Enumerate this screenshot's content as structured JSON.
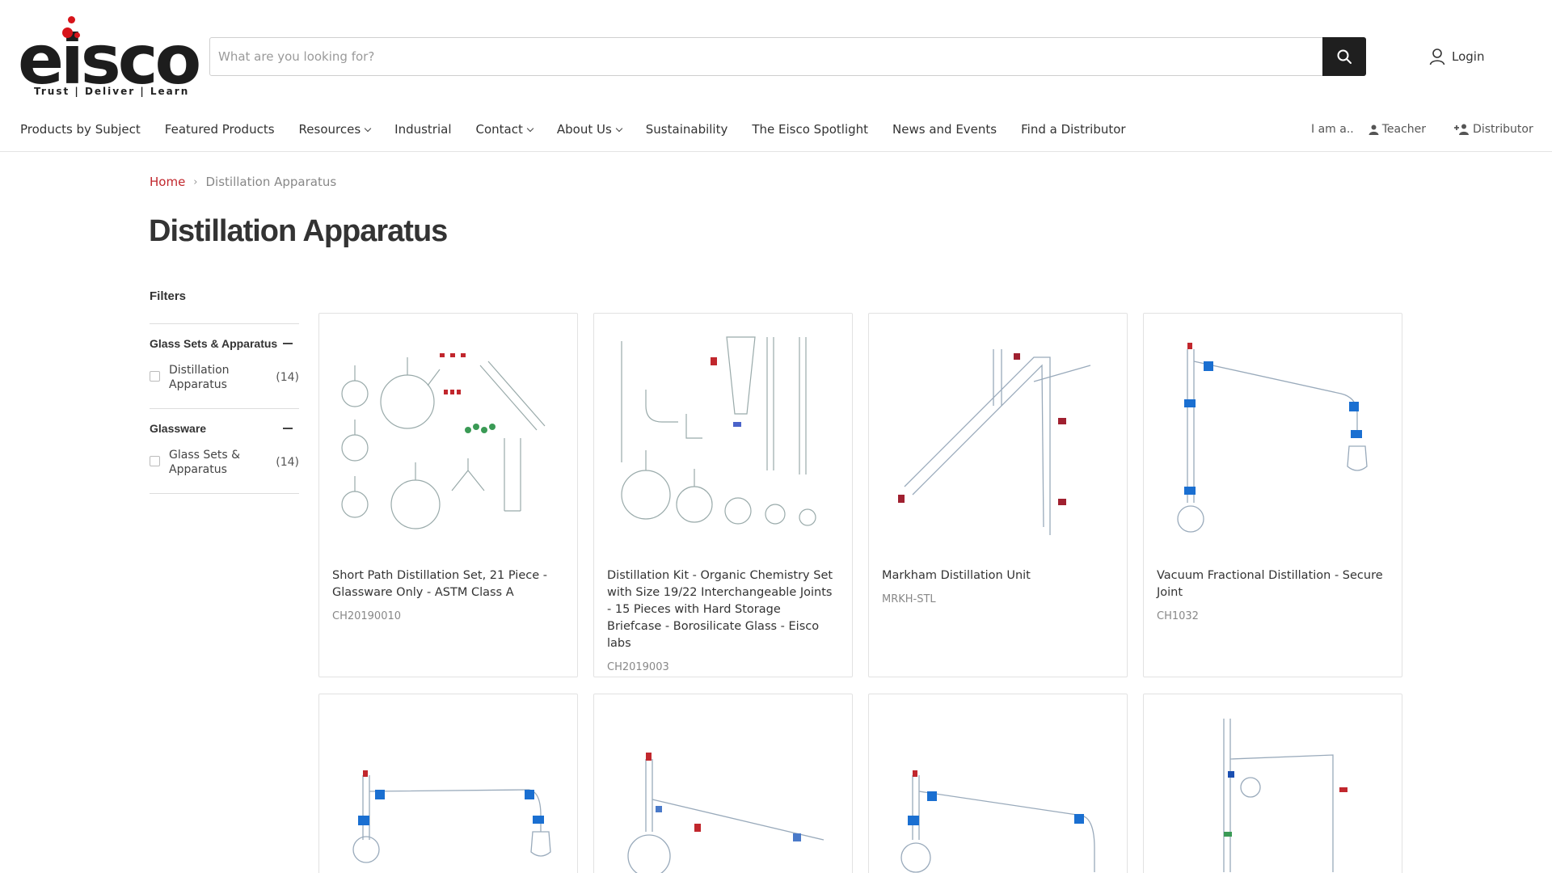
{
  "brand": {
    "logo_text": "eisco",
    "tagline": "Trust | Deliver | Learn",
    "accent": "#d7141a"
  },
  "search": {
    "placeholder": "What are you looking for?"
  },
  "header": {
    "login_label": "Login"
  },
  "nav": {
    "items": [
      {
        "label": "Products by Subject"
      },
      {
        "label": "Featured Products"
      },
      {
        "label": "Resources"
      },
      {
        "label": "Industrial"
      },
      {
        "label": "Contact"
      },
      {
        "label": "About Us"
      },
      {
        "label": "Sustainability"
      },
      {
        "label": "The Eisco Spotlight"
      },
      {
        "label": "News and Events"
      },
      {
        "label": "Find a Distributor"
      }
    ]
  },
  "role": {
    "prompt": "I am a..",
    "teacher": "Teacher",
    "distributor": "Distributor"
  },
  "breadcrumb": {
    "home": "Home",
    "current": "Distillation Apparatus"
  },
  "page": {
    "title": "Distillation Apparatus"
  },
  "filters": {
    "title": "Filters",
    "groups": [
      {
        "name": "Glass Sets & Apparatus",
        "option": "Distillation Apparatus",
        "count": "(14)"
      },
      {
        "name": "Glassware",
        "option": "Glass Sets & Apparatus",
        "count": "(14)"
      }
    ]
  },
  "products": [
    {
      "name": "Short Path Distillation Set, 21 Piece - Glassware Only - ASTM Class A",
      "sku": "CH20190010"
    },
    {
      "name": "Distillation Kit - Organic Chemistry Set with Size 19/22 Interchangeable Joints - 15 Pieces with Hard Storage Briefcase - Borosilicate Glass - Eisco labs",
      "sku": "CH2019003"
    },
    {
      "name": "Markham Distillation Unit",
      "sku": "MRKH-STL"
    },
    {
      "name": "Vacuum Fractional Distillation - Secure Joint",
      "sku": "CH1032"
    },
    {
      "name": "",
      "sku": ""
    },
    {
      "name": "",
      "sku": ""
    },
    {
      "name": "",
      "sku": ""
    },
    {
      "name": "",
      "sku": ""
    }
  ]
}
